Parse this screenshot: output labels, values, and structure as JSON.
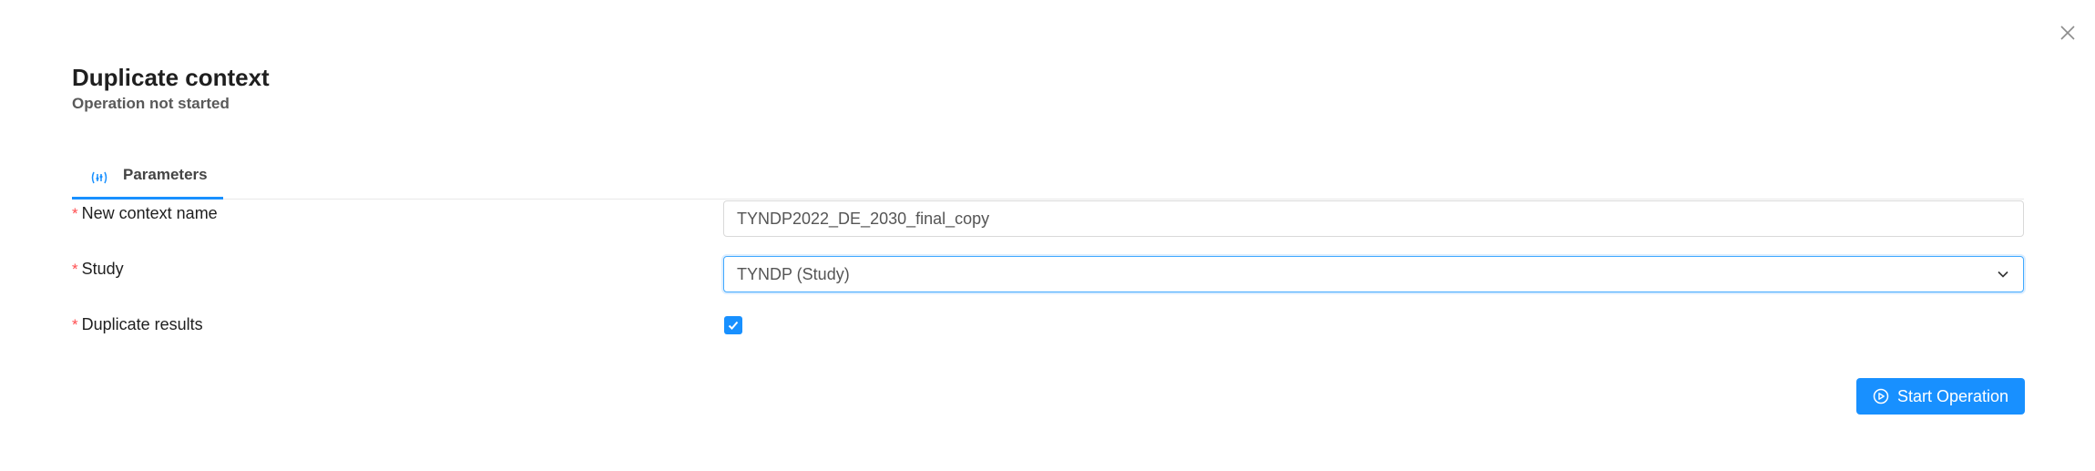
{
  "dialog": {
    "title": "Duplicate context",
    "subtitle": "Operation not started"
  },
  "tabs": [
    {
      "label": "Parameters",
      "icon": "parameters-icon",
      "active": true
    }
  ],
  "form": {
    "required_marker": "*",
    "context_name": {
      "label": "New context name",
      "value": "TYNDP2022_DE_2030_final_copy"
    },
    "study": {
      "label": "Study",
      "value": "TYNDP (Study)"
    },
    "duplicate_results": {
      "label": "Duplicate results",
      "checked": true
    }
  },
  "actions": {
    "start_label": "Start Operation"
  },
  "colors": {
    "primary": "#1890ff",
    "required": "#ff4d4f"
  }
}
